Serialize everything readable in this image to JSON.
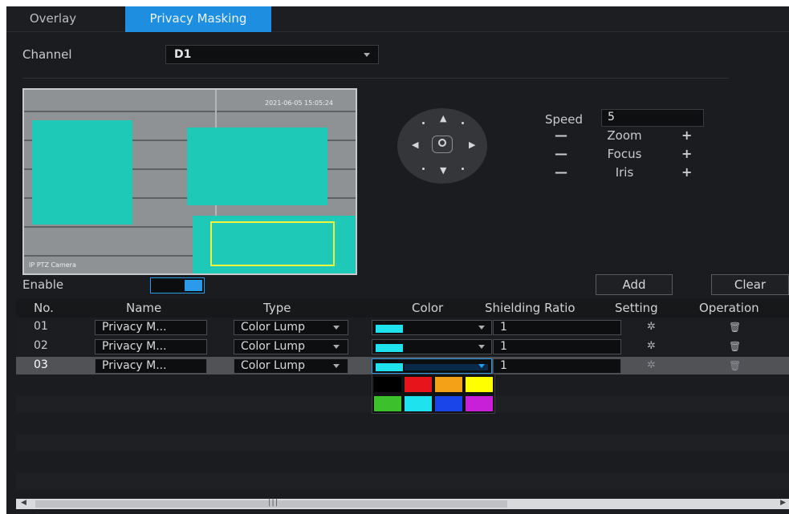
{
  "tabs": [
    "Overlay",
    "Privacy Masking"
  ],
  "channel": {
    "label": "Channel",
    "value": "D1"
  },
  "video": {
    "timestamp": "2021-06-05 15:05:24",
    "camera_name": "IP PTZ Camera"
  },
  "ptz": {
    "speed_label": "Speed",
    "speed_value": "5",
    "zoom_label": "Zoom",
    "focus_label": "Focus",
    "iris_label": "Iris"
  },
  "enable": {
    "label": "Enable",
    "state": "on"
  },
  "buttons": {
    "add": "Add",
    "clear": "Clear"
  },
  "table": {
    "columns": [
      "No.",
      "Name",
      "Type",
      "Color",
      "Shielding Ratio",
      "Setting",
      "Operation"
    ],
    "rows": [
      {
        "no": "01",
        "name": "Privacy M...",
        "type": "Color Lump",
        "color": "#1ee3ef",
        "ratio": "1"
      },
      {
        "no": "02",
        "name": "Privacy M...",
        "type": "Color Lump",
        "color": "#1ee3ef",
        "ratio": "1"
      },
      {
        "no": "03",
        "name": "Privacy M...",
        "type": "Color Lump",
        "color": "#1ee3ef",
        "ratio": "1"
      }
    ]
  },
  "palette": [
    "#000000",
    "#e8141b",
    "#f5a117",
    "#ffff00",
    "#3cc02c",
    "#1ee3ef",
    "#1a45e8",
    "#c81fd8"
  ],
  "colors": {
    "accent": "#1d8ee0",
    "mask": "#1fc9b8",
    "selection_outline": "#f4f23a"
  }
}
